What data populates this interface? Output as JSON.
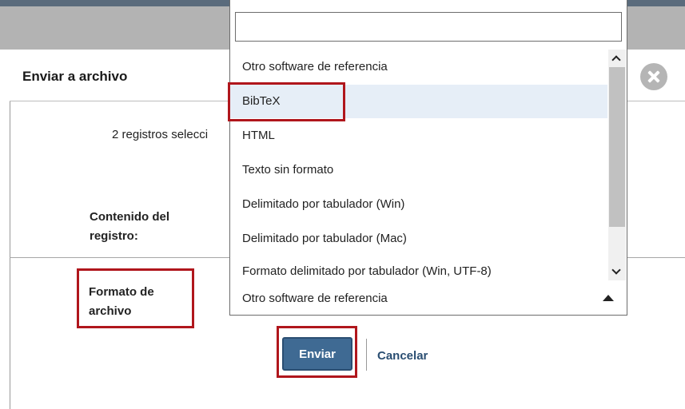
{
  "dialog": {
    "title": "Enviar a archivo",
    "selected_records_text": "2 registros selecci",
    "content_label": "Contenido del registro:",
    "format_label": "Formato de archivo",
    "format_value": "Otro software de referencia",
    "send_label": "Enviar",
    "cancel_label": "Cancelar"
  },
  "dropdown": {
    "search_value": "",
    "options": [
      "Otro software de referencia",
      "BibTeX",
      "HTML",
      "Texto sin formato",
      "Delimitado por tabulador (Win)",
      "Delimitado por tabulador (Mac)",
      "Formato delimitado por tabulador (Win, UTF-8)"
    ],
    "highlighted": "BibTeX"
  },
  "colors": {
    "accent": "#3f6a93",
    "annotation": "#b0161c",
    "highlight": "#e6eef7"
  },
  "icons": [
    "close-icon",
    "chevron-up-icon",
    "chevron-down-icon",
    "triangle-up-icon"
  ]
}
